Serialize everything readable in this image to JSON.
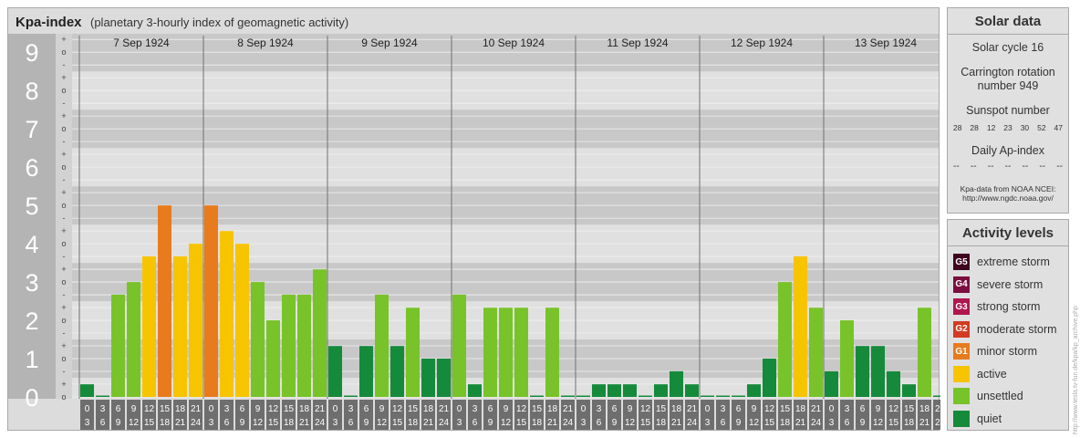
{
  "chart_data": {
    "type": "bar",
    "title": "Kpa-index",
    "subtitle": "(planetary 3-hourly index of geomagnetic activity)",
    "days": [
      "7 Sep 1924",
      "8 Sep 1924",
      "9 Sep 1924",
      "10 Sep 1924",
      "11 Sep 1924",
      "12 Sep 1924",
      "13 Sep 1924"
    ],
    "interval_labels": [
      [
        "0",
        "3"
      ],
      [
        "3",
        "6"
      ],
      [
        "6",
        "9"
      ],
      [
        "9",
        "12"
      ],
      [
        "12",
        "15"
      ],
      [
        "15",
        "18"
      ],
      [
        "18",
        "21"
      ],
      [
        "21",
        "24"
      ]
    ],
    "y_ticks": [
      "0",
      "1",
      "2",
      "3",
      "4",
      "5",
      "6",
      "7",
      "8",
      "9"
    ],
    "y_sublabels": [
      "o",
      "+",
      "-"
    ],
    "ylim": [
      0,
      9.33
    ],
    "values": [
      0.33,
      0,
      2.67,
      3,
      3.67,
      5,
      3.67,
      4,
      5,
      4.33,
      4,
      3,
      2,
      2.67,
      2.67,
      3.33,
      1.33,
      0,
      1.33,
      2.67,
      1.33,
      2.33,
      1,
      1,
      2.67,
      0.33,
      2.33,
      2.33,
      2.33,
      0,
      2.33,
      0,
      0,
      0.33,
      0.33,
      0.33,
      0,
      0.33,
      0.67,
      0.33,
      0,
      0,
      0,
      0.33,
      1,
      3,
      3.67,
      2.33,
      0.67,
      2,
      1.33,
      1.33,
      0.67,
      0.33,
      2.33,
      0
    ],
    "level_colors": {
      "quiet": "#158a3b",
      "unsettled": "#79c32a",
      "active": "#f7c400",
      "G1": "#e87b1d",
      "G2": "#d23b22",
      "G3": "#b0174f",
      "G4": "#7a0f3f",
      "G5": "#3e0521"
    },
    "grid": true
  },
  "solar_data": {
    "title": "Solar data",
    "cycle": "Solar cycle 16",
    "carrington_line1": "Carrington rotation",
    "carrington_line2": "number 949",
    "sunspot_label": "Sunspot number",
    "sunspots": [
      "28",
      "28",
      "12",
      "23",
      "30",
      "52",
      "47"
    ],
    "ap_label": "Daily Ap-index",
    "ap_values": [
      "--",
      "--",
      "--",
      "--",
      "--",
      "--",
      "--"
    ],
    "credit_line1": "Kpa-data from NOAA NCEI:",
    "credit_line2": "http://www.ngdc.noaa.gov/"
  },
  "activity_levels": {
    "title": "Activity levels",
    "items": [
      {
        "badge": "G5",
        "label": "extreme storm",
        "color": "#3e0521"
      },
      {
        "badge": "G4",
        "label": "severe storm",
        "color": "#7a0f3f"
      },
      {
        "badge": "G3",
        "label": "strong storm",
        "color": "#b0174f"
      },
      {
        "badge": "G2",
        "label": "moderate storm",
        "color": "#d23b22"
      },
      {
        "badge": "G1",
        "label": "minor storm",
        "color": "#e87b1d"
      },
      {
        "badge": "",
        "label": "active",
        "color": "#f7c400"
      },
      {
        "badge": "",
        "label": "unsettled",
        "color": "#79c32a"
      },
      {
        "badge": "",
        "label": "quiet",
        "color": "#158a3b"
      }
    ]
  },
  "side_credit": "http://www.tesla.tv-fun.de/kpa/kp_archive.php"
}
